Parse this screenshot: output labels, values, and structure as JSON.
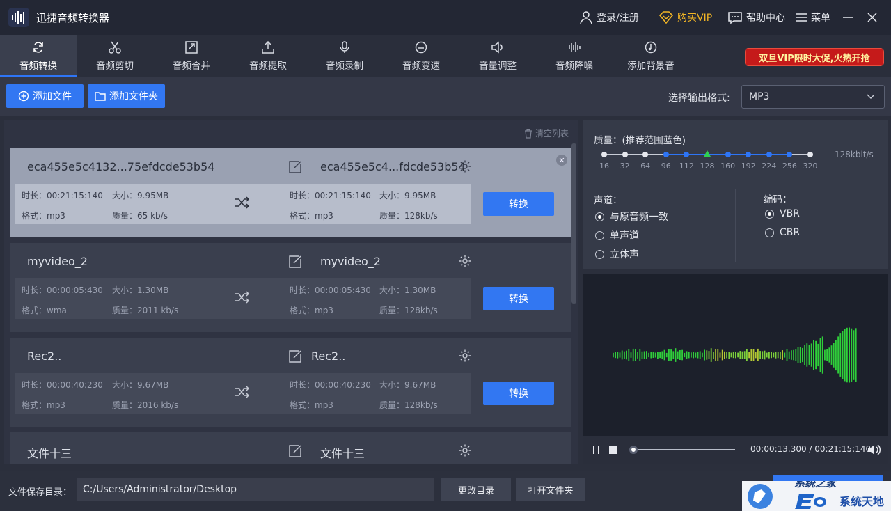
{
  "app": {
    "title": "迅捷音频转换器"
  },
  "titlebar": {
    "login": "登录/注册",
    "vip": "购买VIP",
    "help": "帮助中心",
    "menu": "菜单"
  },
  "toolbar": {
    "tools": [
      {
        "label": "音频转换",
        "icon": "refresh-icon"
      },
      {
        "label": "音频剪切",
        "icon": "scissors-icon"
      },
      {
        "label": "音频合并",
        "icon": "merge-icon"
      },
      {
        "label": "音频提取",
        "icon": "upload-icon"
      },
      {
        "label": "音频录制",
        "icon": "microphone-icon"
      },
      {
        "label": "音频变速",
        "icon": "speed-icon"
      },
      {
        "label": "音量调整",
        "icon": "volume-icon"
      },
      {
        "label": "音频降噪",
        "icon": "noise-icon"
      },
      {
        "label": "添加背景音",
        "icon": "music-icon"
      }
    ],
    "promo": "双旦VIP限时大促,火热开抢"
  },
  "actions": {
    "add_file": "添加文件",
    "add_folder": "添加文件夹",
    "format_label": "选择输出格式:",
    "format_value": "MP3"
  },
  "list": {
    "clear": "清空列表",
    "items": [
      {
        "name": "eca455e5c4132...75efdcde53b54",
        "out_name": "eca455e5c4...fdcde53b54",
        "src": {
          "duration": "时长：00:21:15:140",
          "size": "大小：9.95MB",
          "format": "格式：mp3",
          "quality": "质量：65 kb/s"
        },
        "dst": {
          "duration": "时长：00:21:15:140",
          "size": "大小：9.95MB",
          "format": "格式：mp3",
          "quality": "质量：128kb/s"
        },
        "convert": "转换"
      },
      {
        "name": "myvideo_2",
        "out_name": "myvideo_2",
        "src": {
          "duration": "时长：00:00:05:430",
          "size": "大小：1.30MB",
          "format": "格式：wma",
          "quality": "质量：2011 kb/s"
        },
        "dst": {
          "duration": "时长：00:00:05:430",
          "size": "大小：1.30MB",
          "format": "格式：mp3",
          "quality": "质量：128kb/s"
        },
        "convert": "转换"
      },
      {
        "name": "Rec2..",
        "out_name": "Rec2..",
        "src": {
          "duration": "时长：00:00:40:230",
          "size": "大小：9.67MB",
          "format": "格式：mp3",
          "quality": "质量：2016 kb/s"
        },
        "dst": {
          "duration": "时长：00:00:40:230",
          "size": "大小：9.67MB",
          "format": "格式：mp3",
          "quality": "质量：128kb/s"
        },
        "convert": "转换"
      },
      {
        "name": "文件十三",
        "out_name": "文件十三"
      }
    ]
  },
  "settings": {
    "quality_label": "质量：(推荐范围蓝色)",
    "quality_ticks": [
      "16",
      "32",
      "64",
      "96",
      "112",
      "128",
      "160",
      "192",
      "224",
      "256",
      "320"
    ],
    "quality_value": "128kbit/s",
    "channel_label": "声道：",
    "channels": [
      "与原音频一致",
      "单声道",
      "立体声"
    ],
    "encoding_label": "编码：",
    "encodings": [
      "VBR",
      "CBR"
    ]
  },
  "player": {
    "time": "00:00:13.300 / 00:21:15:140",
    "progress": 0.0
  },
  "footer": {
    "save_label": "文件保存目录：",
    "path": "C:/Users/Administrator/Desktop",
    "change_dir": "更改目录",
    "open_folder": "打开文件夹"
  },
  "watermark": {
    "text": "系统天地",
    "text2": "系统之家"
  }
}
